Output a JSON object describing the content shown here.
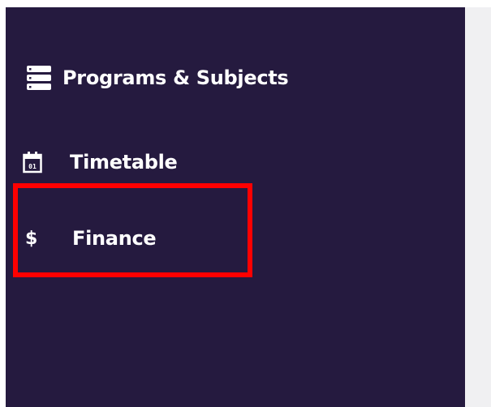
{
  "sidebar": {
    "background_color": "#251a3f",
    "items": [
      {
        "label": "Programs & Subjects",
        "icon": "server-stack-icon"
      },
      {
        "label": "Timetable",
        "icon": "calendar-icon",
        "icon_text": "01"
      },
      {
        "label": "Finance",
        "icon": "dollar-icon",
        "icon_text": "$"
      }
    ]
  },
  "annotation": {
    "highlight_color": "#ff0000",
    "highlighted_item": "Finance"
  },
  "content_area": {
    "background_color": "#f0f0f2"
  }
}
